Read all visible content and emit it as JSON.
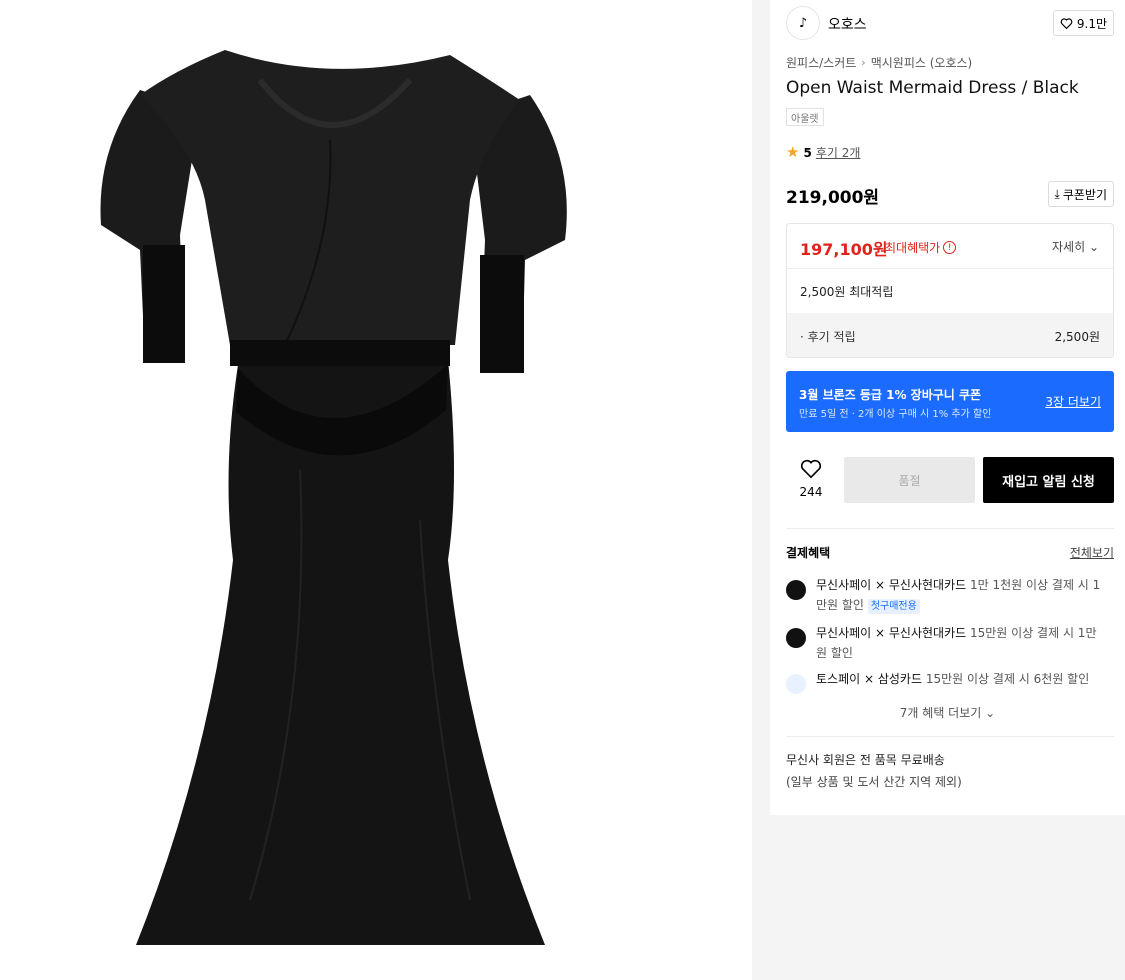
{
  "brand": {
    "name": "오호스",
    "logo_text": "♪",
    "likes": "9.1만"
  },
  "breadcrumb": [
    "원피스/스커트",
    "맥시원피스 (오호스)"
  ],
  "product": {
    "title": "Open Waist Mermaid Dress / Black",
    "tag": "아울렛",
    "rating": "5",
    "reviews": "후기 2개",
    "price": "219,000원"
  },
  "coupon_button": "쿠폰받기",
  "benefit": {
    "max_price": "197,100원",
    "max_label": "최대혜택가",
    "detail": "자세히",
    "points": "2,500원 최대적립",
    "review_points_label": "· 후기 적립",
    "review_points_value": "2,500원"
  },
  "promo": {
    "title": "3월 브론즈 등급 1% 장바구니 쿠폰",
    "subtitle": "만료 5일 전 · 2개 이상 구매 시 1% 추가 할인",
    "link": "3장 더보기"
  },
  "actions": {
    "wish_count": "244",
    "soldout": "품절",
    "restock": "재입고 알림 신청"
  },
  "payment": {
    "heading": "결제혜택",
    "view_all": "전체보기",
    "items": [
      {
        "provider": "무신사페이 × 무신사현대카드",
        "desc": "1만 1천원 이상 결제 시 1만원 할인",
        "badge": "첫구매전용"
      },
      {
        "provider": "무신사페이 × 무신사현대카드",
        "desc": "15만원 이상 결제 시 1만원 할인"
      },
      {
        "provider": "토스페이 × 삼성카드",
        "desc": "15만원 이상 결제 시 6천원 할인"
      }
    ],
    "more": "7개 혜택 더보기"
  },
  "shipping": {
    "line1": "무신사 회원은 전 품목 무료배송",
    "line2": "(일부 상품 및 도서 산간 지역 제외)"
  },
  "colors": {
    "accent_red": "#e0231a",
    "promo_blue": "#1c6bff"
  }
}
